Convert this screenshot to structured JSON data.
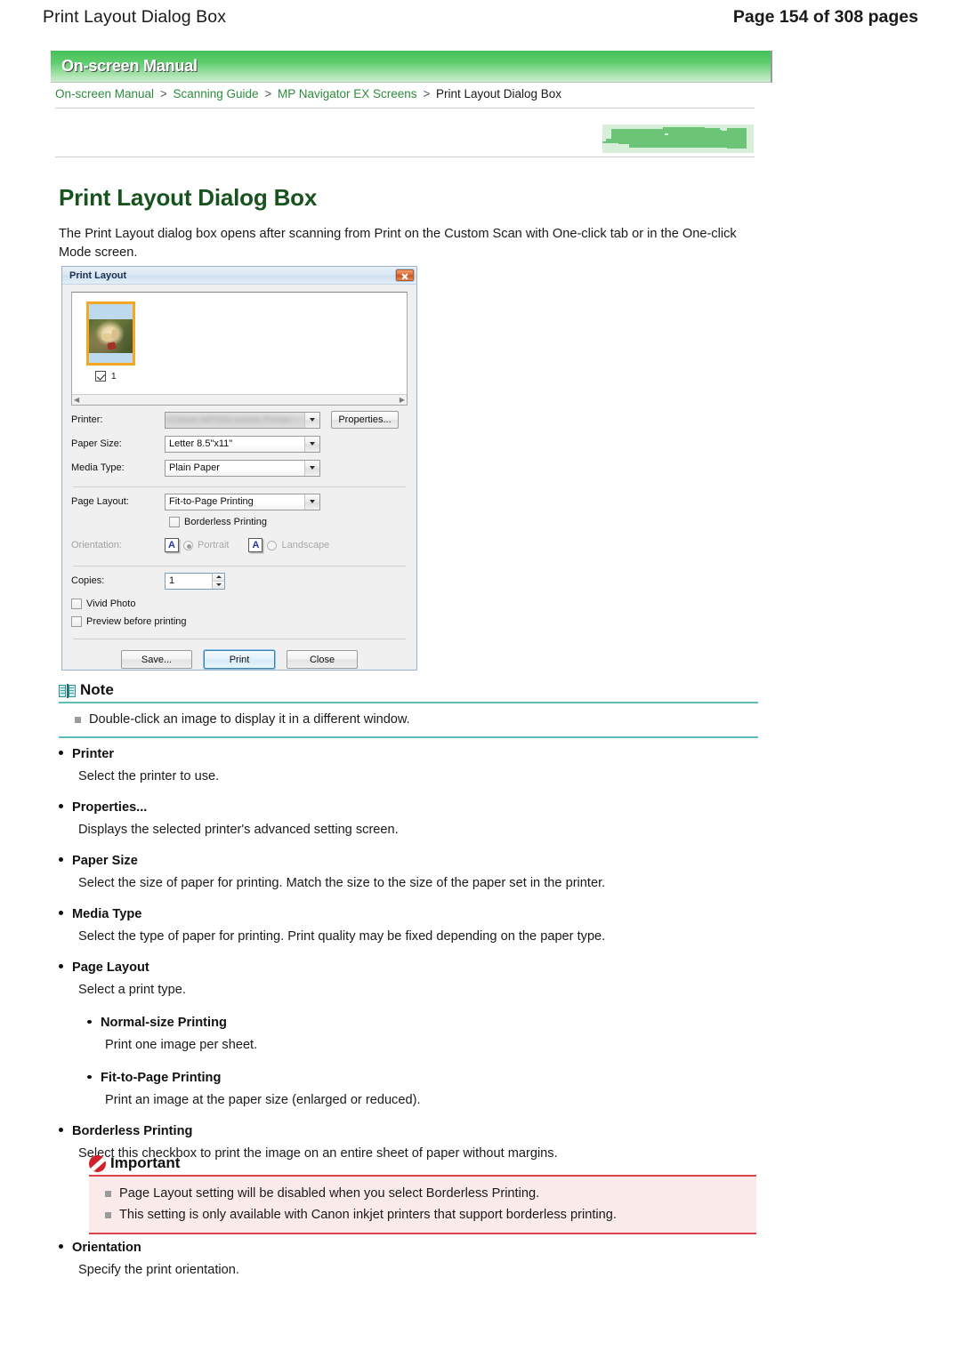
{
  "header": {
    "doc_title": "Print Layout Dialog Box",
    "page_counter": "Page 154 of 308 pages"
  },
  "banner": {
    "label": "On-screen Manual"
  },
  "breadcrumb": {
    "items": [
      {
        "text": "On-screen Manual",
        "current": false
      },
      {
        "text": "Scanning Guide",
        "current": false
      },
      {
        "text": "MP Navigator EX Screens",
        "current": false
      },
      {
        "text": "Print Layout Dialog Box",
        "current": true
      }
    ],
    "separator": ">"
  },
  "main": {
    "title": "Print Layout Dialog Box",
    "intro": "The Print Layout dialog box opens after scanning from Print on the Custom Scan with One-click tab or in the One-click Mode screen."
  },
  "dialog": {
    "title": "Print Layout",
    "close_icon": "close-icon",
    "thumbnail": {
      "index_label": "1",
      "checked": true
    },
    "printer_label": "Printer:",
    "printer_value": "Canon MP990 series Printer",
    "properties_button": "Properties...",
    "paper_size_label": "Paper Size:",
    "paper_size_value": "Letter 8.5\"x11\"",
    "media_type_label": "Media Type:",
    "media_type_value": "Plain Paper",
    "page_layout_label": "Page Layout:",
    "page_layout_value": "Fit-to-Page Printing",
    "borderless_label": "Borderless Printing",
    "borderless_checked": false,
    "orientation_label": "Orientation:",
    "orientation_portrait": "Portrait",
    "orientation_landscape": "Landscape",
    "orientation_icon_letter": "A",
    "copies_label": "Copies:",
    "copies_value": "1",
    "vivid_photo_label": "Vivid Photo",
    "vivid_photo_checked": false,
    "preview_label": "Preview before printing",
    "preview_checked": false,
    "save_button": "Save...",
    "print_button": "Print",
    "close_button": "Close"
  },
  "note": {
    "heading": "Note",
    "icon": "book-icon",
    "items": [
      "Double-click an image to display it in a different window."
    ]
  },
  "definitions": [
    {
      "term": "Printer",
      "desc": "Select the printer to use."
    },
    {
      "term": "Properties...",
      "desc": "Displays the selected printer's advanced setting screen."
    },
    {
      "term": "Paper Size",
      "desc": "Select the size of paper for printing. Match the size to the size of the paper set in the printer."
    },
    {
      "term": "Media Type",
      "desc": "Select the type of paper for printing. Print quality may be fixed depending on the paper type."
    },
    {
      "term": "Page Layout",
      "desc": "Select a print type.",
      "subitems": [
        {
          "term": "Normal-size Printing",
          "desc": "Print one image per sheet."
        },
        {
          "term": "Fit-to-Page Printing",
          "desc": "Print an image at the paper size (enlarged or reduced)."
        }
      ]
    },
    {
      "term": "Borderless Printing",
      "desc": "Select this checkbox to print the image on an entire sheet of paper without margins."
    }
  ],
  "important": {
    "heading": "Important",
    "icon": "prohibition-icon",
    "items": [
      "Page Layout setting will be disabled when you select Borderless Printing.",
      "This setting is only available with Canon inkjet printers that support borderless printing."
    ]
  },
  "tail_definitions": [
    {
      "term": "Orientation",
      "desc": "Specify the print orientation."
    }
  ],
  "colors": {
    "banner_green": "#45c057",
    "link_green": "#2e8b3d",
    "title_green": "#18521f",
    "note_teal": "#5cbdbd",
    "important_red": "#d9454b",
    "important_bg": "#fbeaea",
    "selection_orange": "#f5a623"
  }
}
